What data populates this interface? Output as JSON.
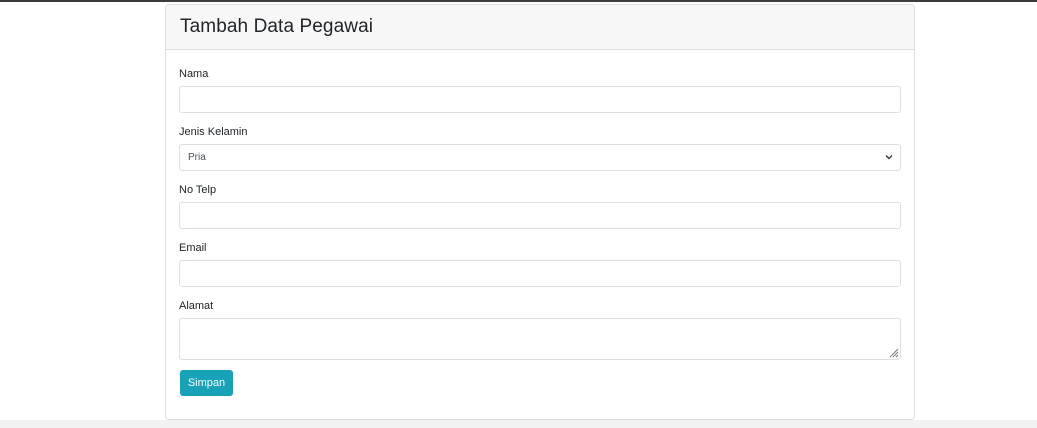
{
  "card": {
    "title": "Tambah Data Pegawai"
  },
  "form": {
    "nama": {
      "label": "Nama",
      "value": "",
      "placeholder": ""
    },
    "jenis_kelamin": {
      "label": "Jenis Kelamin",
      "selected": "Pria"
    },
    "no_telp": {
      "label": "No Telp",
      "value": "",
      "placeholder": ""
    },
    "email": {
      "label": "Email",
      "value": "",
      "placeholder": ""
    },
    "alamat": {
      "label": "Alamat",
      "value": ""
    },
    "submit_label": "Simpan"
  },
  "colors": {
    "button": "#17a2b8",
    "header_bg": "#f7f7f7",
    "border": "#dfdfdf"
  },
  "icons": {
    "select": "chevron-down-icon",
    "textarea": "resize-handle-icon"
  }
}
